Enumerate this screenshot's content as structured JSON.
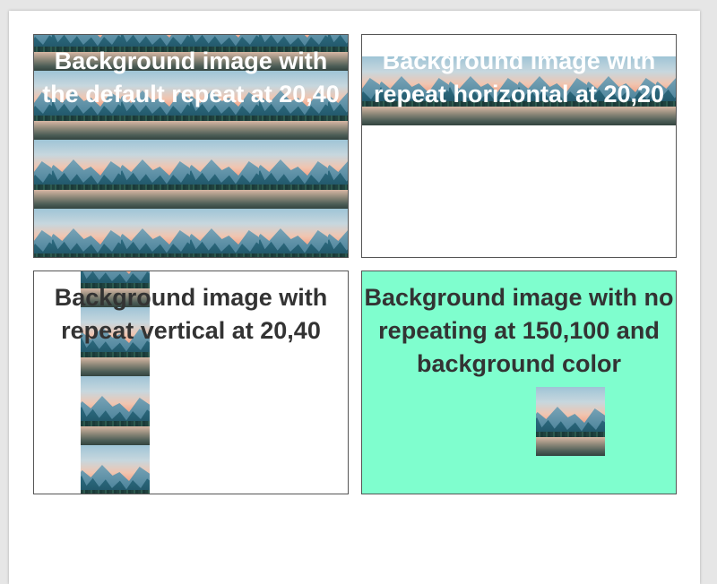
{
  "boxes": [
    {
      "caption": "Background image with the default repeat at 20,40",
      "repeat": "repeat",
      "offset": "20,40"
    },
    {
      "caption": "Background image with repeat horizontal at 20,20",
      "repeat": "repeat-x",
      "offset": "20,20"
    },
    {
      "caption": "Background image with repeat vertical at 20,40",
      "repeat": "repeat-y",
      "offset": "20,40"
    },
    {
      "caption": "Background image with no repeating at 150,100 and background color",
      "repeat": "no-repeat",
      "offset": "150,100"
    }
  ],
  "colors": {
    "page_background": "#ffffff",
    "canvas_background": "#e6e6e6",
    "box_border": "#555555",
    "caption_white": "#ffffff",
    "caption_dark": "#333333",
    "box4_background": "#7ffece"
  },
  "image_description": "landscape-tile"
}
